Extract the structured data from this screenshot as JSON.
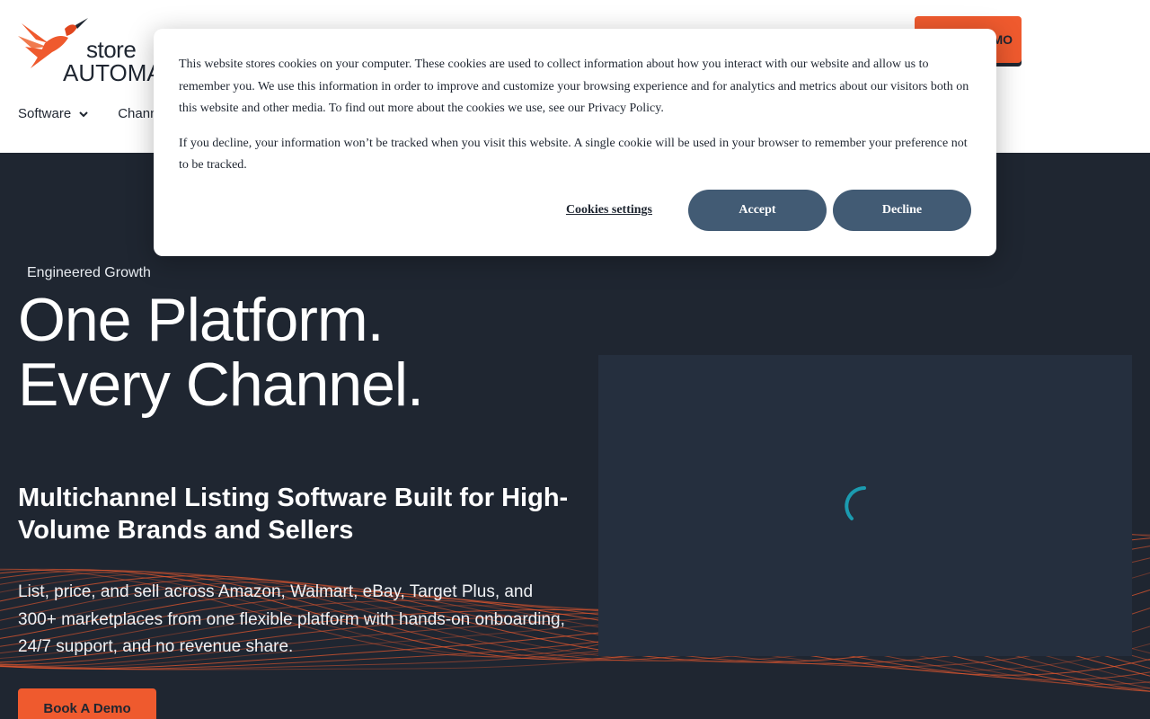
{
  "logo": {
    "line1": "store",
    "line2": "AUTOMATOR"
  },
  "header": {
    "nav": [
      {
        "label": "Software",
        "has_dropdown": true
      },
      {
        "label": "Channels",
        "has_dropdown": true
      }
    ],
    "cta_label": "BOOK A DEMO"
  },
  "hero": {
    "eyebrow": "Engineered Growth",
    "headline_line1": "One Platform.",
    "headline_line2": "Every Channel.",
    "subheadline": "Multichannel Listing Software Built for High-Volume Brands and Sellers",
    "description": "List, price, and sell across Amazon, Walmart, eBay, Target Plus, and 300+ marketplaces from one flexible platform with hands-on onboarding, 24/7 support, and no revenue share.",
    "cta_label": "Book A Demo"
  },
  "cookie_banner": {
    "paragraph1": "This website stores cookies on your computer. These cookies are used to collect information about how you interact with our website and allow us to remember you. We use this information in order to improve and customize your browsing experience and for analytics and metrics about our visitors both on this website and other media. To find out more about the cookies we use, see our Privacy Policy.",
    "paragraph2": "If you decline, your information won’t be tracked when you visit this website. A single cookie will be used in your browser to remember your preference not to be tracked.",
    "settings_label": "Cookies settings",
    "accept_label": "Accept",
    "decline_label": "Decline"
  },
  "colors": {
    "brand_orange": "#ef5a2e",
    "dark_navy": "#1f2631",
    "button_slate": "#425b74",
    "spinner_teal": "#1b9bb0"
  }
}
